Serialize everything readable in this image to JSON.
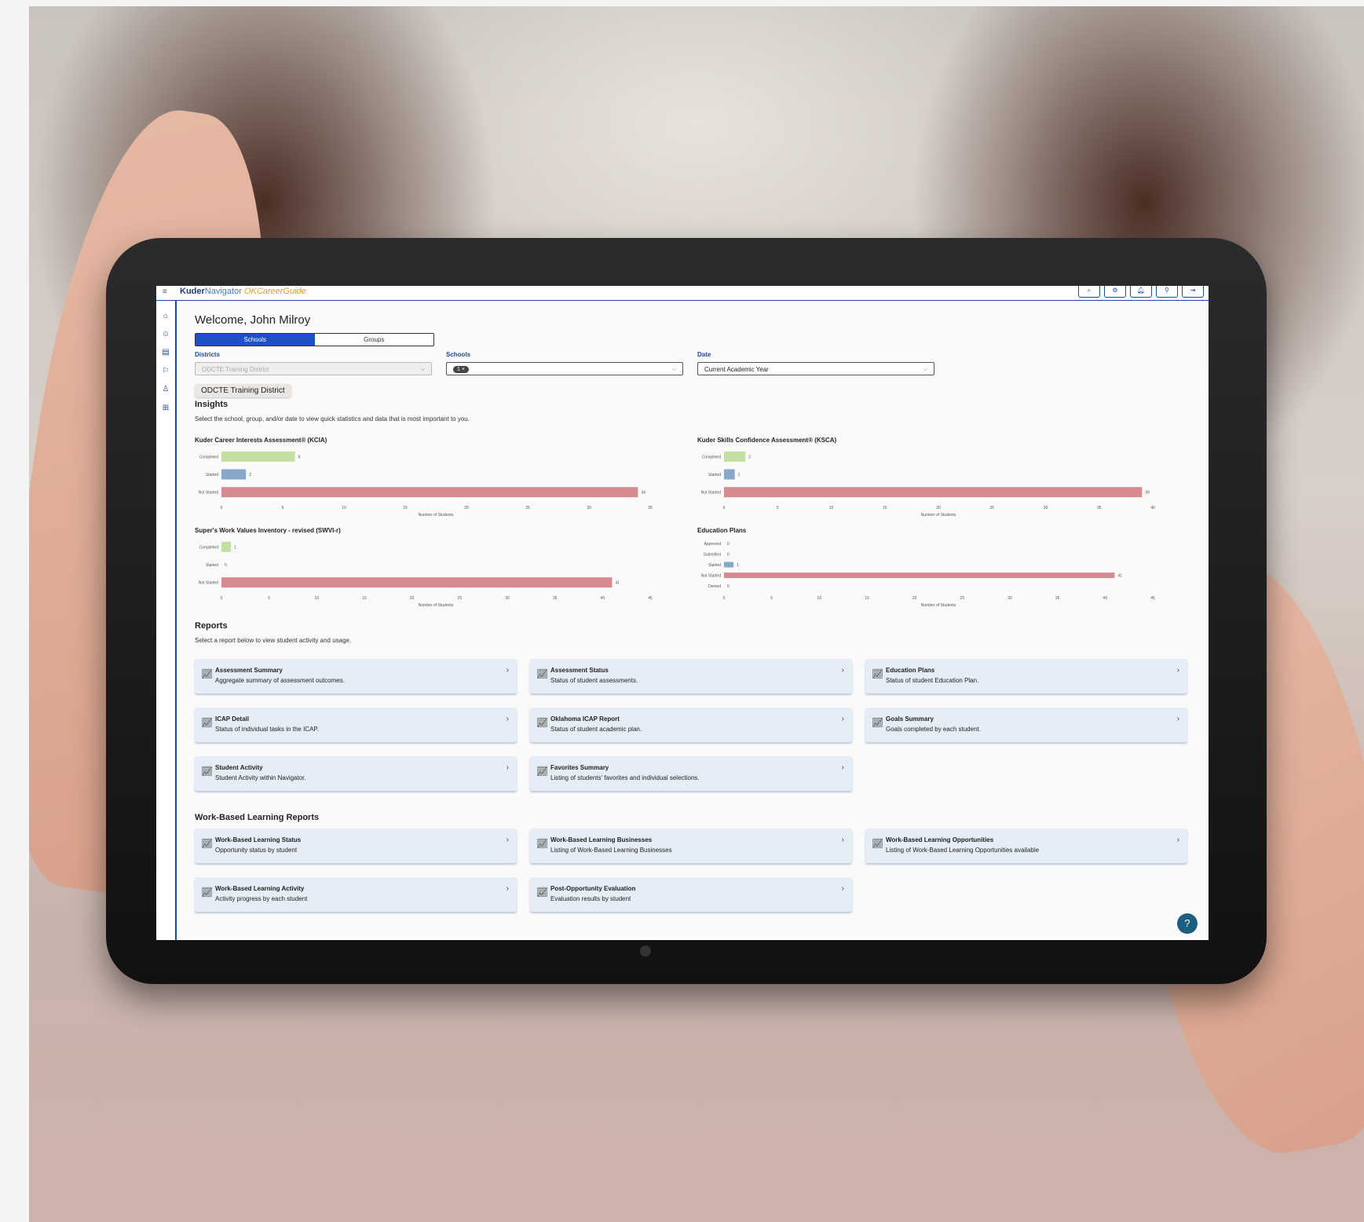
{
  "header": {
    "menu_icon": "hamburger-icon",
    "logo_text": "Kuder",
    "logo_sub": "Navigator",
    "logo_ok": "OKCareerGuide",
    "actions": [
      "search-icon",
      "gear-icon",
      "bell-icon",
      "user-icon",
      "logout-icon"
    ]
  },
  "sidenav": {
    "icons": [
      "home-icon",
      "users-icon",
      "folder-tree-icon",
      "briefcase-icon",
      "people-icon",
      "org-chart-icon"
    ]
  },
  "welcome": "Welcome, John Milroy",
  "toggle": {
    "schools": "Schools",
    "groups": "Groups",
    "active": "schools"
  },
  "filters": {
    "districts_label": "Districts",
    "districts_value": "ODCTE Training District",
    "schools_label": "Schools",
    "schools_chip": "1",
    "date_label": "Date",
    "date_value": "Current Academic Year"
  },
  "tooltip": "ODCTE Training District",
  "insights": {
    "title": "Insights",
    "description": "Select the school, group, and/or date to view quick statistics and data that is most important to you."
  },
  "colors": {
    "completed": "#c3dfa3",
    "started": "#89a8c9",
    "not_started": "#d78a90",
    "accent": "#1f4aa8"
  },
  "chart_data": [
    {
      "type": "bar",
      "title": "Kuder Career Interests Assessment® (KCIA)",
      "categories": [
        "Completed",
        "Started",
        "Not Started"
      ],
      "values": [
        6,
        2,
        34
      ],
      "xlabel": "Number of Students",
      "xlim": [
        0,
        35
      ],
      "ticks": [
        0,
        5,
        10,
        15,
        20,
        25,
        30,
        35
      ]
    },
    {
      "type": "bar",
      "title": "Kuder Skills Confidence Assessment® (KSCA)",
      "categories": [
        "Completed",
        "Started",
        "Not Started"
      ],
      "values": [
        2,
        1,
        39
      ],
      "xlabel": "Number of Students",
      "xlim": [
        0,
        40
      ],
      "ticks": [
        0,
        5,
        10,
        15,
        20,
        25,
        30,
        35,
        40
      ]
    },
    {
      "type": "bar",
      "title": "Super's Work Values Inventory - revised (SWVI-r)",
      "categories": [
        "Completed",
        "Started",
        "Not Started"
      ],
      "values": [
        1,
        0,
        41
      ],
      "xlabel": "Number of Students",
      "xlim": [
        0,
        45
      ],
      "ticks": [
        0,
        5,
        10,
        15,
        20,
        25,
        30,
        35,
        40,
        45
      ]
    },
    {
      "type": "bar",
      "title": "Education Plans",
      "categories": [
        "Approved",
        "Submitted",
        "Started",
        "Not Started",
        "Denied"
      ],
      "values": [
        0,
        0,
        1,
        41,
        0
      ],
      "xlabel": "Number of Students",
      "xlim": [
        0,
        45
      ],
      "ticks": [
        0,
        5,
        10,
        15,
        20,
        25,
        30,
        35,
        40,
        45
      ]
    }
  ],
  "reports": {
    "title": "Reports",
    "description": "Select a report below to view student activity and usage.",
    "items": [
      {
        "title": "Assessment Summary",
        "desc": "Aggregate summary of assessment outcomes."
      },
      {
        "title": "Assessment Status",
        "desc": "Status of student assessments."
      },
      {
        "title": "Education Plans",
        "desc": "Status of student Education Plan."
      },
      {
        "title": "ICAP Detail",
        "desc": "Status of individual tasks in the ICAP."
      },
      {
        "title": "Oklahoma ICAP Report",
        "desc": "Status of student academic plan."
      },
      {
        "title": "Goals Summary",
        "desc": "Goals completed by each student."
      },
      {
        "title": "Student Activity",
        "desc": "Student Activity within Navigator."
      },
      {
        "title": "Favorites Summary",
        "desc": "Listing of students' favorites and individual selections."
      }
    ]
  },
  "wbl": {
    "title": "Work-Based Learning Reports",
    "items": [
      {
        "title": "Work-Based Learning Status",
        "desc": "Opportunity status by student"
      },
      {
        "title": "Work-Based Learning Businesses",
        "desc": "Listing of Work-Based Learning Businesses"
      },
      {
        "title": "Work-Based Learning Opportunities",
        "desc": "Listing of Work-Based Learning Opportunities available"
      },
      {
        "title": "Work-Based Learning Activity",
        "desc": "Activity progress by each student"
      },
      {
        "title": "Post-Opportunity Evaluation",
        "desc": "Evaluation results by student"
      }
    ]
  },
  "help_icon": "help-bubble-icon"
}
